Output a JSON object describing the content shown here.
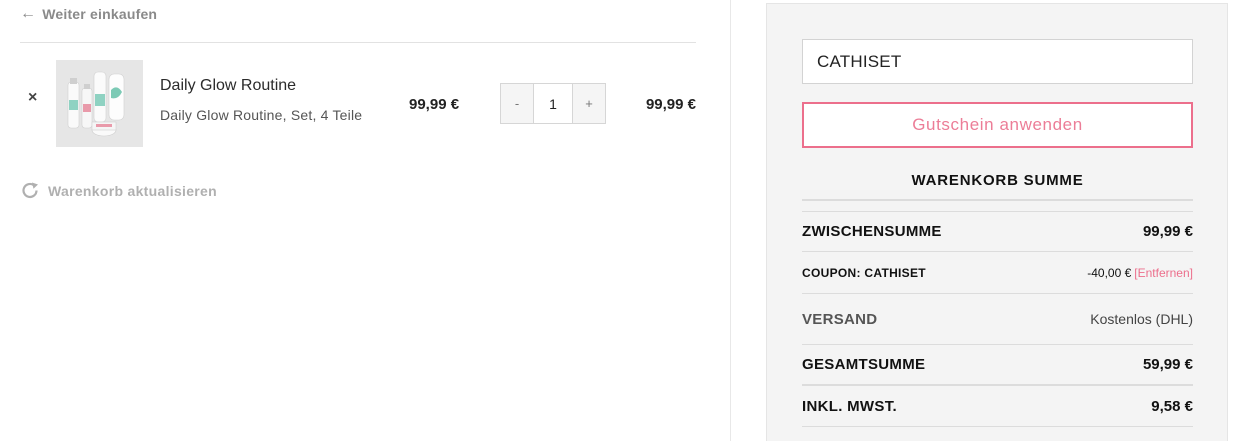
{
  "back_link": {
    "arrow": "←",
    "label": "Weiter einkaufen"
  },
  "cart": {
    "items": [
      {
        "remove_symbol": "×",
        "name": "Daily Glow Routine",
        "variant": "Daily Glow Routine, Set, 4 Teile",
        "unit_price": "99,99 €",
        "quantity": "1",
        "qty_minus": "-",
        "qty_plus": "+",
        "line_total": "99,99 €"
      }
    ],
    "update_label": "Warenkorb aktualisieren"
  },
  "coupon": {
    "input_value": "CATHISET",
    "apply_label": "Gutschein anwenden"
  },
  "totals": {
    "heading": "WARENKORB SUMME",
    "subtotal_label": "ZWISCHENSUMME",
    "subtotal_value": "99,99 €",
    "coupon_label": "COUPON: CATHISET",
    "coupon_value": "-40,00 €",
    "coupon_remove": "[Entfernen]",
    "shipping_label": "VERSAND",
    "shipping_value": "Kostenlos (DHL)",
    "total_label": "GESAMTSUMME",
    "total_value": "59,99 €",
    "tax_label": "INKL. MWST.",
    "tax_value": "9,58 €"
  },
  "colors": {
    "accent": "#ec6f8c",
    "muted_text": "#8a8a8a",
    "sidebar_bg": "#f4f4f4"
  },
  "icons": {
    "back": "arrow-left-icon",
    "remove": "close-icon",
    "refresh": "refresh-icon"
  }
}
